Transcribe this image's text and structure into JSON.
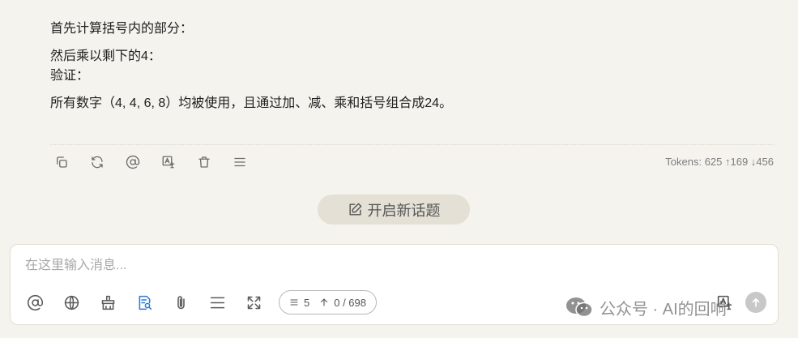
{
  "message": {
    "line1": "首先计算括号内的部分：",
    "line2": "然后乘以剩下的4：",
    "line3": "验证：",
    "line4": "所有数字（4, 4, 6, 8）均被使用，且通过加、减、乘和括号组合成24。"
  },
  "actions": {
    "icons": [
      "copy-icon",
      "regenerate-icon",
      "mention-icon",
      "translate-icon",
      "delete-icon",
      "menu-icon"
    ]
  },
  "tokens": {
    "text": "Tokens: 625 ↑169 ↓456"
  },
  "new_topic": {
    "label": "开启新话题"
  },
  "input": {
    "placeholder": "在这里输入消息...",
    "value": ""
  },
  "toolbar": {
    "icons": [
      "mention-icon",
      "globe-icon",
      "broom-icon",
      "knowledge-search-icon",
      "paperclip-icon",
      "divider-icon",
      "expand-icon"
    ],
    "context_count": "5",
    "token_count": "0 / 698"
  },
  "watermark": {
    "text": "公众号 · AI的回响"
  },
  "colors": {
    "background": "#f5f3ee",
    "active_icon": "#2a7bd9",
    "new_topic_bg": "#e4e0d5"
  }
}
